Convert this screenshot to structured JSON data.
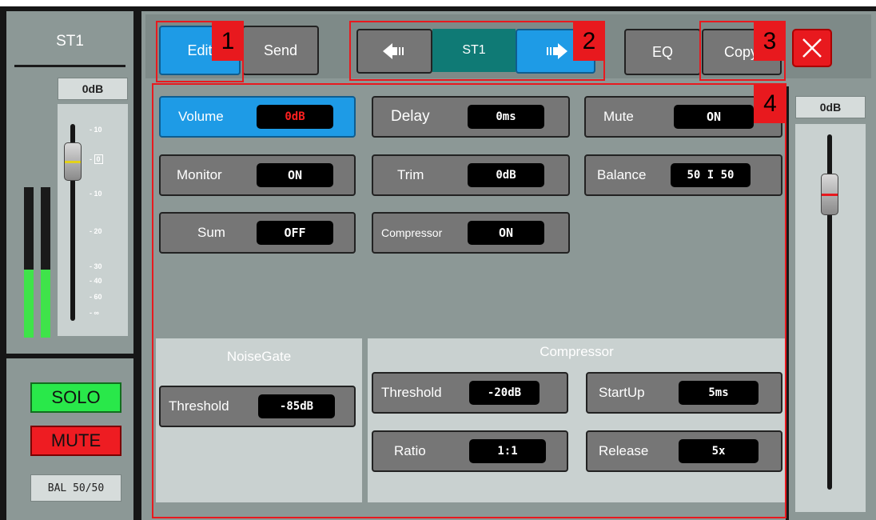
{
  "channel_strip": {
    "name": "ST1",
    "fader_value": "0dB",
    "scale": [
      "10",
      "0",
      "10",
      "20",
      "30",
      "40",
      "60",
      "∞"
    ],
    "solo_label": "SOLO",
    "mute_label": "MUTE",
    "balance_label": "BAL 50/50"
  },
  "top_bar": {
    "edit_label": "Edit",
    "send_label": "Send",
    "current_channel": "ST1",
    "eq_label": "EQ",
    "copy_label": "Copy"
  },
  "callouts": [
    "1",
    "2",
    "3",
    "4"
  ],
  "params": {
    "volume": {
      "label": "Volume",
      "value": "0dB"
    },
    "delay": {
      "label": "Delay",
      "value": "0ms"
    },
    "mute": {
      "label": "Mute",
      "value": "ON"
    },
    "monitor": {
      "label": "Monitor",
      "value": "ON"
    },
    "trim": {
      "label": "Trim",
      "value": "0dB"
    },
    "balance": {
      "label": "Balance",
      "value": "50 I 50"
    },
    "sum": {
      "label": "Sum",
      "value": "OFF"
    },
    "compressor": {
      "label": "Compressor",
      "value": "ON"
    }
  },
  "noisegate": {
    "title": "NoiseGate",
    "threshold": {
      "label": "Threshold",
      "value": "-85dB"
    }
  },
  "compressor_panel": {
    "title": "Compressor",
    "threshold": {
      "label": "Threshold",
      "value": "-20dB"
    },
    "startup": {
      "label": "StartUp",
      "value": "5ms"
    },
    "ratio": {
      "label": "Ratio",
      "value": "1:1"
    },
    "release": {
      "label": "Release",
      "value": "5x"
    }
  },
  "right_fader": {
    "value": "0dB"
  },
  "colors": {
    "active_blue": "#1e9be6",
    "callout_red": "#e8191e",
    "meter_green": "#3fe34a",
    "panel_gray": "#8c9896",
    "solo_green": "#29e84a"
  },
  "meter_levels": {
    "left": 0.45,
    "right": 0.45
  }
}
